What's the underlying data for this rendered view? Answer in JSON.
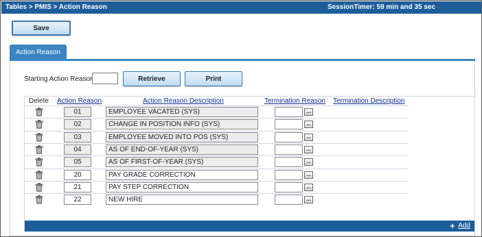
{
  "header": {
    "breadcrumb": "Tables > PMIS > Action Reason",
    "session_timer": "SessionTimer: 59 min and 35 sec"
  },
  "toolbar": {
    "save_label": "Save"
  },
  "tab": {
    "label": "Action Reason"
  },
  "filter": {
    "label": "Starting Action Reason:",
    "value": "",
    "retrieve_label": "Retrieve",
    "print_label": "Print"
  },
  "grid": {
    "columns": [
      "Delete",
      "Action Reason",
      "Action Reason Description",
      "Termination Reason",
      "Termination Description"
    ],
    "rows": [
      {
        "code": "01",
        "description": "EMPLOYEE VACATED (SYS)",
        "editable": false,
        "termination_reason": ""
      },
      {
        "code": "02",
        "description": "CHANGE IN POSITION INFO (SYS)",
        "editable": false,
        "termination_reason": ""
      },
      {
        "code": "03",
        "description": "EMPLOYEE MOVED INTO POS (SYS)",
        "editable": false,
        "termination_reason": ""
      },
      {
        "code": "04",
        "description": "AS OF END-OF-YEAR (SYS)",
        "editable": false,
        "termination_reason": ""
      },
      {
        "code": "05",
        "description": "AS OF FIRST-OF-YEAR (SYS)",
        "editable": false,
        "termination_reason": ""
      },
      {
        "code": "20",
        "description": "PAY GRADE CORRECTION",
        "editable": true,
        "termination_reason": ""
      },
      {
        "code": "21",
        "description": "PAY STEP CORRECTION",
        "editable": true,
        "termination_reason": ""
      },
      {
        "code": "22",
        "description": "NEW HIRE",
        "editable": true,
        "termination_reason": ""
      }
    ],
    "lookup_label": "...",
    "add_label": "Add",
    "add_icon": "+"
  },
  "colors": {
    "bar": "#1d5e9a",
    "tab": "#3a85c2",
    "link": "#0a2e8c"
  }
}
